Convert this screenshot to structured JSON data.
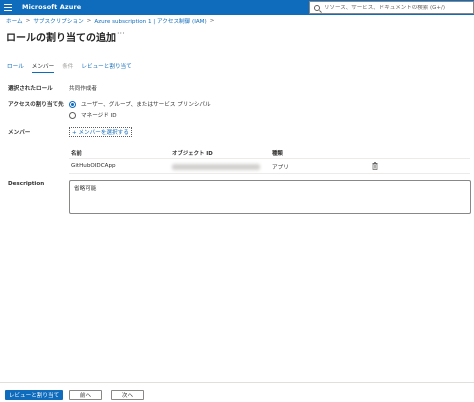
{
  "topbar": {
    "brand": "Microsoft Azure",
    "search_placeholder": "リソース、サービス、ドキュメントの検索 (G+/)"
  },
  "breadcrumb": [
    "ホーム",
    "サブスクリプション",
    "Azure subscription 1 | アクセス制御 (IAM)"
  ],
  "page": {
    "title": "ロールの割り当ての追加",
    "more": "···"
  },
  "tabs": [
    {
      "label": "ロール",
      "state": "link"
    },
    {
      "label": "メンバー",
      "state": "active"
    },
    {
      "label": "条件",
      "state": "disabled"
    },
    {
      "label": "レビューと割り当て",
      "state": "link"
    }
  ],
  "form": {
    "selected_role_label": "選択されたロール",
    "selected_role_value": "共同作成者",
    "assign_to_label": "アクセスの割り当て先",
    "assign_options": [
      {
        "label": "ユーザー、グループ、またはサービス プリンシパル",
        "selected": true
      },
      {
        "label": "マネージド ID",
        "selected": false
      }
    ],
    "members_label": "メンバー",
    "select_members_link": "+ メンバーを選択する",
    "table": {
      "headers": [
        "名前",
        "オブジェクト ID",
        "種類"
      ],
      "rows": [
        {
          "name": "GitHubOIDCApp",
          "type": "アプリ"
        }
      ]
    },
    "description_label": "Description",
    "description_value": "省略可能"
  },
  "footer": {
    "review_assign": "レビューと割り当て",
    "previous": "前へ",
    "next": "次へ"
  },
  "colors": {
    "accent": "#0f6cbd",
    "text": "#323130",
    "border": "#8a8886"
  }
}
